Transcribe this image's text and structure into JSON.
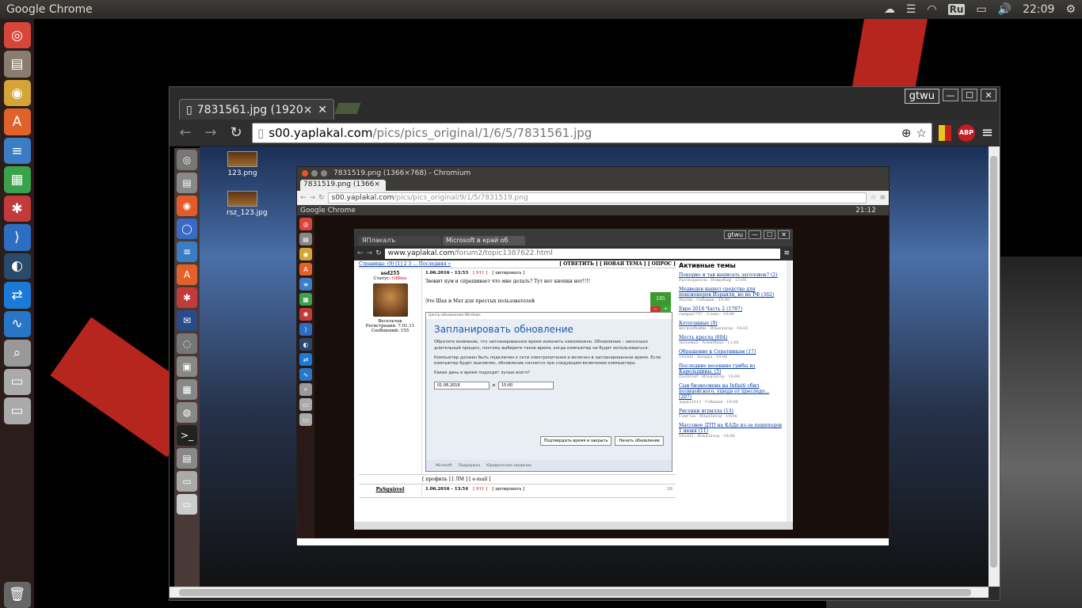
{
  "topbar": {
    "app_title": "Google Chrome",
    "language": "Ru",
    "clock": "22:09"
  },
  "launcher": {
    "icons": [
      "ubuntu-dash-icon",
      "files-icon",
      "chrome-icon",
      "software-center-icon",
      "libreoffice-writer-icon",
      "libreoffice-calc-icon",
      "system-settings-icon",
      "vscode-icon",
      "steam-icon",
      "teamviewer-icon",
      "system-monitor-icon",
      "search-icon",
      "drive-icon",
      "drive-icon",
      "trash-icon"
    ]
  },
  "outer_window": {
    "user": "gtwu",
    "tab_title": "7831561.jpg (1920×1",
    "url_host": "s00.yaplakal.com",
    "url_path": "/pics/pics_original/1/6/5/7831561.jpg",
    "abp_label": "ABP"
  },
  "inner_desktop": {
    "files": [
      {
        "name": "123.png"
      },
      {
        "name": "rsz_123.jpg"
      }
    ]
  },
  "window2": {
    "title": "7831519.png (1366×768) - Chromium",
    "tab_title": "7831519.png (1366×",
    "url_host": "s00.yaplakal.com",
    "url_path": "/pics/pics_original/9/1/5/7831519.png",
    "panel_title": "Google Chrome",
    "clock": "21:12"
  },
  "window3": {
    "user": "gtwu",
    "tab1": "ЯПлакалъ",
    "tab2": "Microsoft в край об",
    "url_host": "www.yaplakal.com",
    "url_path": "/forum2/topic1387622.html",
    "pages_label": "Страницы: (9) [1] 2 3 ... Последняя »",
    "topic_actions": "[ ОТВЕТИТЬ ] [ НОВАЯ ТЕМА ] [ ОПРОС ]",
    "post1": {
      "author": "asd255",
      "status_label": "Статус:",
      "status": "Offline",
      "role": "Весельчак",
      "registered": "Регистрация: 7.01.11",
      "messages": "Сообщений: 155",
      "date": "1.06.2016 - 13:53",
      "num": "[ 911 ]",
      "quote": "[ цитировать ]",
      "text1": "Звонит кум и спрашивает что мне делать? Тут нет кнопки нет!!!!",
      "text2": "Это Шах и Мат для простых пользователей",
      "rating": "195",
      "footer": "[ профиль ] [ ЛМ ] [ e-mail ]"
    },
    "update_dialog": {
      "bar": "Центр обновления Windows",
      "title": "Запланировать обновление",
      "p1": "Обратите внимание, что запланированное время изменить невозможно. Обновление – несколько длительный процесс, поэтому выберите такое время, когда компьютер не будет использоваться.",
      "p2": "Компьютер должен быть подключен к сети электропитания и включен в запланированное время. Если компьютер будет выключен, обновление начнется при следующем включении компьютера.",
      "question": "Какие день и время подходят лучше всего?",
      "date": "01.06.2016",
      "at": "в",
      "time": "15:00",
      "btn_confirm": "Подтвердить время и закрыть",
      "btn_start": "Начать обновление",
      "footer": [
        "Microsoft",
        "Поддержка",
        "Юридические сведения"
      ]
    },
    "post2": {
      "author": "PaSquirrel",
      "date": "1.06.2016 - 13:54",
      "num": "[ 911 ]",
      "quote": "[ цитировать ]",
      "rating": "26"
    },
    "sidebar": {
      "title": "Активные темы",
      "items": [
        {
          "title": "Покорно и так написать заголовок? (2)",
          "meta": "Растворитель  ·  Вовкобаф  ·  13:06"
        },
        {
          "title": "Медведев нашел средства для пенсионеров Израиля, но не РФ (362)",
          "meta": "Worlds  ·  Собакин  ·  19:00"
        },
        {
          "title": "Евро 2016 Часть 2 (1787)",
          "meta": "смерш1797  ·  Слово  ·  19:06"
        },
        {
          "title": "Котоганные (9)",
          "meta": "могилобыйвь  ·  ИльяЗатор  ·  19:03"
        },
        {
          "title": "Месть кресла (604)",
          "meta": "латьема5  ·  АлекМахо  ·  13:06"
        },
        {
          "title": "Обращение к Соратникам (17)",
          "meta": "VIGAI3  ·  Буорра  ·  19:06"
        },
        {
          "title": "Последние весенние грибы из Карельщины. (5)",
          "meta": "ZloDiOuP  ·  ИльяЗатор  ·  19:06"
        },
        {
          "title": "Сын бизнесмена на Infiniti сбил полицейского, ушедя от преследо... (207)",
          "meta": "лариз2013  ·  Собакин  ·  19:06"
        },
        {
          "title": "Рисунки игрилла (13)",
          "meta": "Сэнг-Gа  ·  ИльяЗатор  ·  19:06"
        },
        {
          "title": "Массовое ДТП на КАДе из-за пешеходов 1 июня (11)",
          "meta": "VIGAI3  ·  ИльяЗатор  ·  19:06"
        }
      ]
    }
  }
}
